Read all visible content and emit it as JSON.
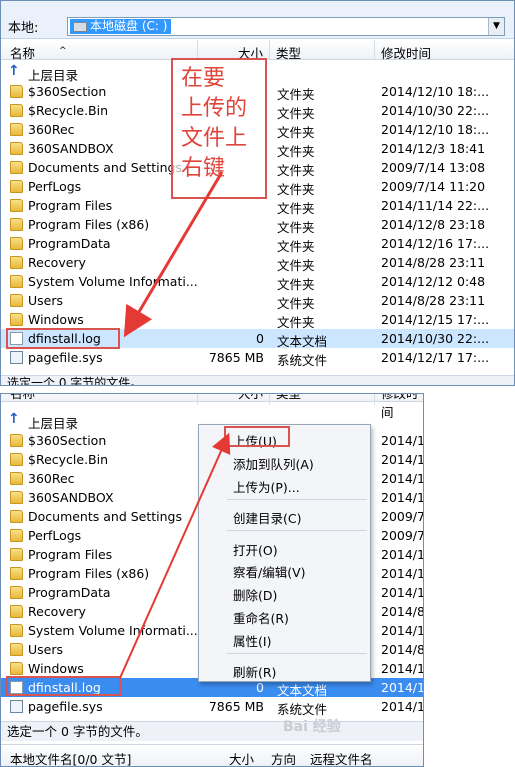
{
  "top": {
    "address_label": "本地:",
    "address_value": "本地磁盘  (C: )",
    "columns": {
      "name": "名称",
      "size": "大小",
      "type": "类型",
      "modified": "修改时间"
    },
    "parent_dir": "上层目录",
    "rows": [
      {
        "name": "$360Section",
        "size": "",
        "type": "文件夹",
        "modified": "2014/12/10 18:..."
      },
      {
        "name": "$Recycle.Bin",
        "size": "",
        "type": "文件夹",
        "modified": "2014/10/30 22:..."
      },
      {
        "name": "360Rec",
        "size": "",
        "type": "文件夹",
        "modified": "2014/12/10 18:..."
      },
      {
        "name": "360SANDBOX",
        "size": "",
        "type": "文件夹",
        "modified": "2014/12/3 18:41"
      },
      {
        "name": "Documents and Settings",
        "size": "",
        "type": "文件夹",
        "modified": "2009/7/14 13:08"
      },
      {
        "name": "PerfLogs",
        "size": "",
        "type": "文件夹",
        "modified": "2009/7/14 11:20"
      },
      {
        "name": "Program Files",
        "size": "",
        "type": "文件夹",
        "modified": "2014/11/14 22:..."
      },
      {
        "name": "Program Files (x86)",
        "size": "",
        "type": "文件夹",
        "modified": "2014/12/8 23:18"
      },
      {
        "name": "ProgramData",
        "size": "",
        "type": "文件夹",
        "modified": "2014/12/16 17:..."
      },
      {
        "name": "Recovery",
        "size": "",
        "type": "文件夹",
        "modified": "2014/8/28 23:11"
      },
      {
        "name": "System Volume Informati...",
        "size": "",
        "type": "文件夹",
        "modified": "2014/12/12 0:48"
      },
      {
        "name": "Users",
        "size": "",
        "type": "文件夹",
        "modified": "2014/8/28 23:11"
      },
      {
        "name": "Windows",
        "size": "",
        "type": "文件夹",
        "modified": "2014/12/15 17:..."
      },
      {
        "name": "dfinstall.log",
        "size": "0",
        "type": "文本文档",
        "modified": "2014/10/30 22:..."
      },
      {
        "name": "pagefile.sys",
        "size": "7865 MB",
        "type": "系统文件",
        "modified": "2014/12/17 17:..."
      }
    ],
    "status": "选定一个 0 字节的文件。",
    "annotation": [
      "在要",
      "上传的",
      "文件上",
      "右键"
    ]
  },
  "bottom": {
    "columns": {
      "name": "名称",
      "size": "大小",
      "type": "类型",
      "modified": "修改时间"
    },
    "parent_dir": "上层目录",
    "rows": [
      {
        "name": "$360Section",
        "size": "",
        "type": "",
        "modified": "2014/1"
      },
      {
        "name": "$Recycle.Bin",
        "size": "",
        "type": "",
        "modified": "2014/1"
      },
      {
        "name": "360Rec",
        "size": "",
        "type": "",
        "modified": "2014/1"
      },
      {
        "name": "360SANDBOX",
        "size": "",
        "type": "",
        "modified": "2014/1"
      },
      {
        "name": "Documents and Settings",
        "size": "",
        "type": "",
        "modified": "2009/7"
      },
      {
        "name": "PerfLogs",
        "size": "",
        "type": "",
        "modified": "2009/7"
      },
      {
        "name": "Program Files",
        "size": "",
        "type": "",
        "modified": "2014/1"
      },
      {
        "name": "Program Files (x86)",
        "size": "",
        "type": "",
        "modified": "2014/1"
      },
      {
        "name": "ProgramData",
        "size": "",
        "type": "",
        "modified": "2014/1"
      },
      {
        "name": "Recovery",
        "size": "",
        "type": "",
        "modified": "2014/8"
      },
      {
        "name": "System Volume Informati...",
        "size": "",
        "type": "",
        "modified": "2014/1"
      },
      {
        "name": "Users",
        "size": "",
        "type": "",
        "modified": "2014/8"
      },
      {
        "name": "Windows",
        "size": "",
        "type": "",
        "modified": "2014/1"
      },
      {
        "name": "dfinstall.log",
        "size": "0",
        "type": "文本文档",
        "modified": "2014/1"
      },
      {
        "name": "pagefile.sys",
        "size": "7865 MB",
        "type": "系统文件",
        "modified": "2014/1"
      }
    ],
    "status": "选定一个 0 字节的文件。",
    "queue_columns": {
      "name": "本地文件名[0/0 文节]",
      "size": "大小",
      "direction": "方向",
      "remote": "远程文件名"
    },
    "context_menu": {
      "upload": "上传(U)",
      "add_queue": "添加到队列(A)",
      "upload_as": "上传为(P)...",
      "create_dir": "创建目录(C)",
      "open": "打开(O)",
      "view_edit": "察看/编辑(V)",
      "delete": "删除(D)",
      "rename": "重命名(R)",
      "properties": "属性(I)",
      "refresh": "刷新(R)"
    },
    "watermark": "Bai 经验"
  }
}
